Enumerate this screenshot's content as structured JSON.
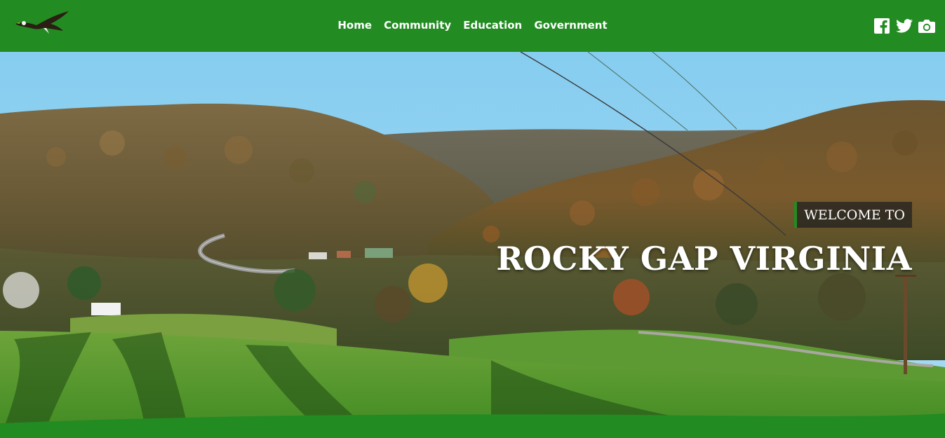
{
  "header": {
    "logo_alt": "eagle logo",
    "nav": [
      {
        "label": "Home"
      },
      {
        "label": "Community"
      },
      {
        "label": "Education"
      },
      {
        "label": "Government"
      }
    ],
    "social": [
      {
        "icon": "facebook-icon"
      },
      {
        "icon": "twitter-icon"
      },
      {
        "icon": "camera-icon"
      }
    ]
  },
  "hero": {
    "welcome": "WELCOME TO",
    "title": "ROCKY GAP VIRGINIA"
  },
  "colors": {
    "brand_green": "#228b22",
    "sky": "#8fd0f0",
    "welcome_bg": "#1e1e1e"
  }
}
